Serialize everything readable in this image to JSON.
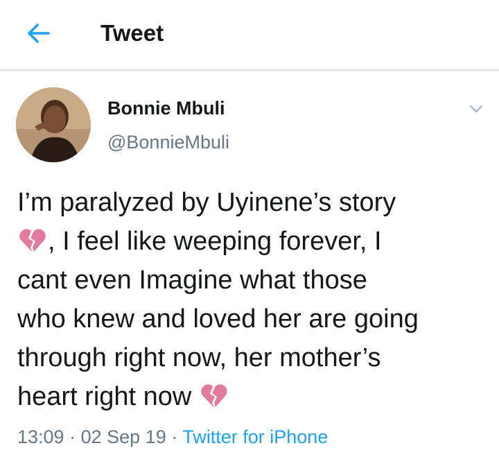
{
  "header": {
    "title": "Tweet",
    "back_icon": "arrow-left-icon",
    "accent": "#1da1f2"
  },
  "author": {
    "name": "Bonnie Mbuli",
    "handle": "@BonnieMbuli",
    "menu_icon": "chevron-down-icon"
  },
  "tweet": {
    "lines": [
      "I’m paralyzed by Uyinene’s story",
      ", I feel like weeping forever, I",
      "cant even Imagine what those",
      "who knew and loved her are going",
      "through right now, her mother’s",
      "heart right now"
    ],
    "emoji": "broken-heart-icon"
  },
  "meta": {
    "time": "13:09",
    "date": "02 Sep 19",
    "separator": "·",
    "source": "Twitter for iPhone"
  }
}
